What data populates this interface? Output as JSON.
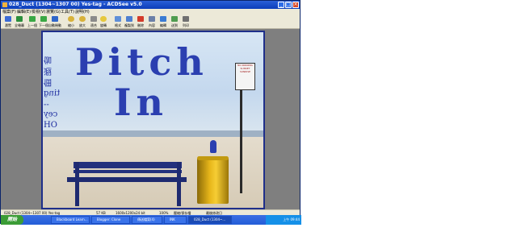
{
  "window": {
    "title": "028_Duct (1304~1307 00) Yes-tag - ACDSee v5.0",
    "minimize": "_",
    "maximize": "□",
    "close": "×"
  },
  "menu": [
    "檔案(F)",
    "編輯(E)",
    "檢視(V)",
    "瀏覽(G)",
    "工具(T)",
    "說明(H)"
  ],
  "toolbar": [
    "瀏覽",
    "全螢幕",
    "上一個",
    "下一個",
    "自動捲動",
    "縮小",
    "放大",
    "適合",
    "旋轉",
    "格式",
    "複製到",
    "刪除",
    "內容",
    "編輯",
    "送到",
    "列印"
  ],
  "image_text": {
    "title_line1": "Pitch",
    "title_line2": "In",
    "side_text": [
      "伽",
      "遐",
      "佃",
      "ɓuᴉʇ",
      "--",
      "ʎǝɔ",
      "HO"
    ],
    "sign_lines": [
      "NO PARKING",
      "SUNSET",
      "SUNRISE"
    ]
  },
  "status": {
    "file": "028_Duct (1304~1307 00) Yes-tag",
    "size": "57 KB",
    "dims": "1600x1200x24 bit",
    "extra": "100%",
    "mode": "壓縮/保存檔",
    "modified": "最後修改日"
  },
  "taskbar": {
    "start": "開始",
    "tasks": [
      "Blackboard Learn...",
      "Blogger: Clone",
      "傳送檔案(4)",
      "INK",
      "028_Duct (1304~..."
    ],
    "clock": "上午 09:44"
  }
}
